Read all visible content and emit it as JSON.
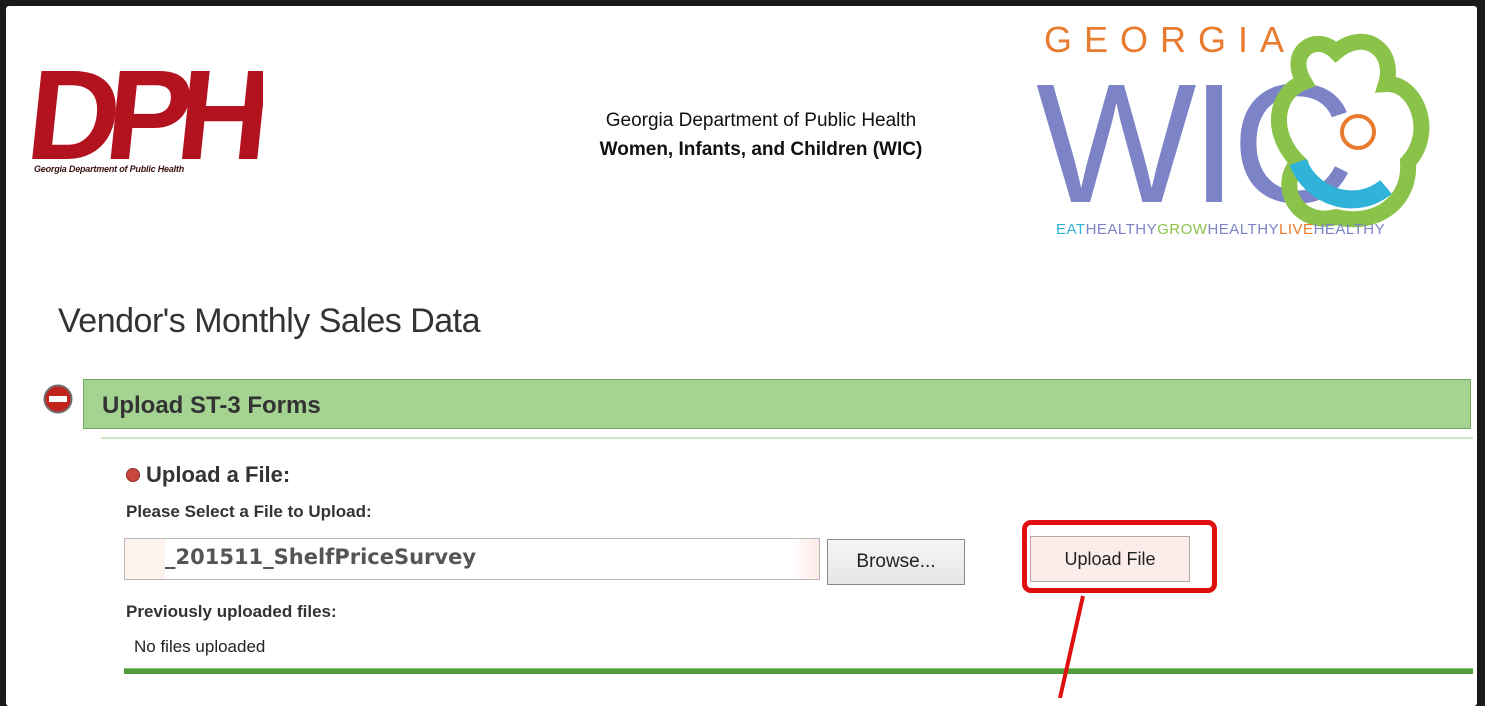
{
  "header": {
    "dph_logo_text": "DPH",
    "dph_logo_caption": "Georgia Department of Public Health",
    "dept_line": "Georgia Department of Public Health",
    "program_line": "Women, Infants, and Children (WIC)",
    "wic_logo_state": "GEORGIA",
    "wic_logo_text": "WIC",
    "wic_tagline": [
      "EAT",
      "HEALTHY",
      "GROW",
      "HEALTHY",
      "LIVE",
      "HEALTHY"
    ]
  },
  "page": {
    "title": "Vendor's Monthly Sales Data"
  },
  "section": {
    "title": "Upload ST-3 Forms",
    "collapse_icon": "minus-circle-icon"
  },
  "upload": {
    "heading": "Upload a File:",
    "select_label": "Please Select a File to Upload:",
    "file_value": "_201511_ShelfPriceSurvey",
    "browse_label": "Browse...",
    "upload_label": "Upload File",
    "previous_label": "Previously uploaded files:",
    "no_files_text": "No files uploaded"
  },
  "colors": {
    "section_bar": "#a5d392",
    "highlight": "#e01010",
    "dph_red": "#b3121f",
    "wic_purple": "#7c83c6",
    "wic_blue": "#2fb3d8",
    "wic_green": "#8bc34a"
  }
}
